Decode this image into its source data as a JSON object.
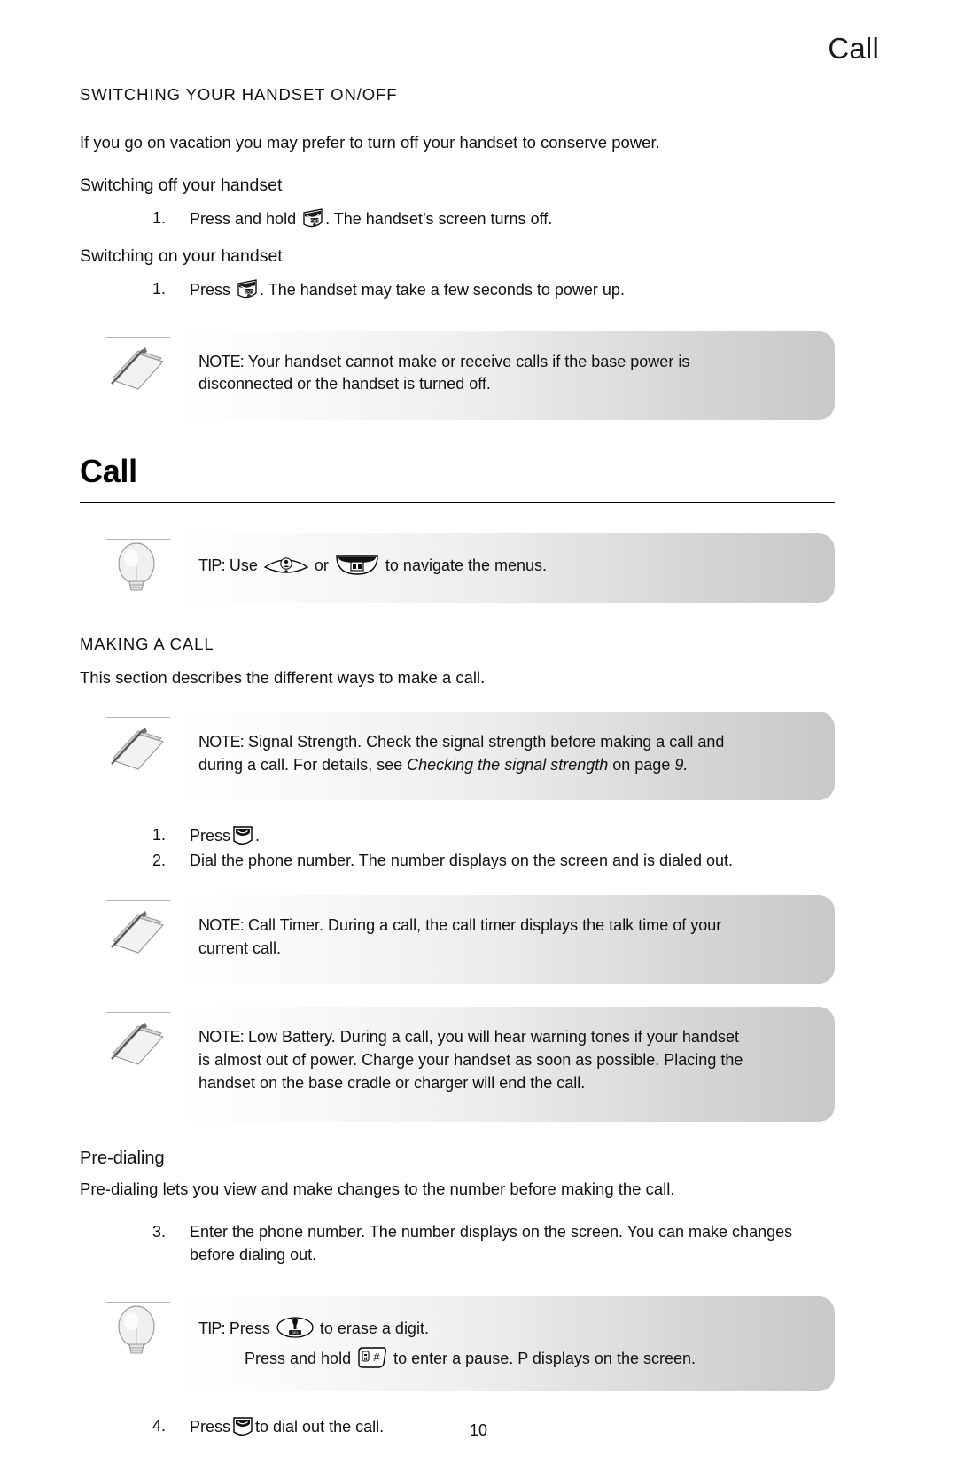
{
  "header": {
    "running_title": "Call"
  },
  "sections": {
    "switching": {
      "heading": "SWITCHING YOUR HANDSET ON/OFF",
      "intro": "If you go on vacation you may prefer to turn off your handset to conserve power.",
      "off_heading": "Switching off your handset",
      "off_step_num": "1.",
      "off_step_before": "Press and hold",
      "off_step_after": ". The handset’s screen turns off.",
      "on_heading": "Switching on your handset",
      "on_step_num": "1.",
      "on_step_before": "Press",
      "on_step_after": ". The handset may take a few seconds to power up."
    },
    "note_base_power": {
      "label": "NOTE:",
      "line1": "Your handset cannot make or receive calls if the base power is",
      "line2": "disconnected or the handset is turned off."
    },
    "chapter": {
      "title": "Call"
    },
    "tip_navigate": {
      "label": "TIP:",
      "before": "Use",
      "middle": "or",
      "after": "to navigate the menus."
    },
    "making_a_call": {
      "heading": "MAKING A CALL",
      "intro": "This section describes the different ways to make a call."
    },
    "note_signal": {
      "label": "NOTE:",
      "line1": "Signal Strength. Check the signal strength before making a call and",
      "line2_a": "during a call. For details, see ",
      "line2_em": "Checking the signal strength",
      "line2_b": " on page ",
      "line2_page": "9."
    },
    "call_steps": {
      "step1_num": "1.",
      "step1_before": "Press",
      "step1_after": ".",
      "step2_num": "2.",
      "step2_text": "Dial the phone number. The number displays on the screen and is dialed out."
    },
    "note_call_timer": {
      "label": "NOTE:",
      "line1": "Call Timer. During a call, the call timer displays the talk time of your",
      "line2": "current call."
    },
    "note_low_battery": {
      "label": "NOTE:",
      "line1": "Low Battery.  During a call, you will hear warning tones if your handset",
      "line2": "is almost out of power. Charge your handset as soon as possible. Placing the",
      "line3": "handset on the base cradle or charger will end the call."
    },
    "predialing": {
      "heading": "Pre-dialing",
      "intro": "Pre-dialing lets you view and make changes to the number before making the call.",
      "step3_num": "3.",
      "step3_line1": "Enter the phone number. The number displays on the screen. You can make changes",
      "step3_line2": "before dialing out.",
      "step4_num": "4.",
      "step4_before": "Press",
      "step4_after": "to dial out the call."
    },
    "tip_predial": {
      "label": "TIP:",
      "line1_before": "Press",
      "line1_after": "to erase a digit.",
      "line2_before": "Press and hold",
      "line2_after": "to enter a pause. P displays on the screen."
    }
  },
  "footer": {
    "page_number": "10"
  },
  "icons": {
    "note_icon": "note-pad-pencil-icon",
    "tip_icon": "light-bulb-icon",
    "exit_key": "exit-power-key-icon",
    "talk_key": "talk-key-icon",
    "nav_key": "navigation-key-icon",
    "menu_key": "menu-key-icon",
    "del_key": "delete-key-icon",
    "hash_key": "hash-pause-key-icon"
  },
  "colors": {
    "text": "#111111",
    "rule": "#000000",
    "callout_gradient_start": "#ffffff",
    "callout_gradient_end": "#c8c8c8"
  }
}
